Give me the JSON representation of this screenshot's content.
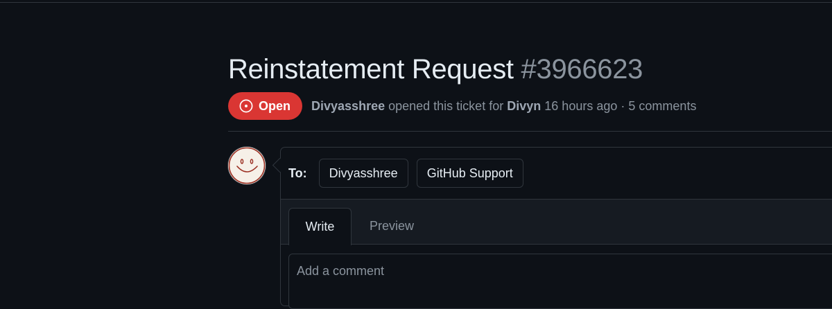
{
  "issue": {
    "title": "Reinstatement Request",
    "number": "#3966623",
    "state": "Open",
    "author": "Divyasshree",
    "opened_text": "opened this ticket for",
    "account": "Divyn",
    "time_ago": "16 hours ago",
    "separator": "·",
    "comments": "5 comments"
  },
  "composer": {
    "to_label": "To:",
    "recipients": [
      "Divyasshree",
      "GitHub Support"
    ],
    "tabs": [
      "Write",
      "Preview"
    ],
    "placeholder": "Add a comment"
  },
  "colors": {
    "background": "#0d1117",
    "open_badge": "#da3633",
    "muted_text": "#8b949e",
    "border": "#30363d"
  },
  "icons": {
    "state": "issue-opened-icon",
    "avatar": "smiley-face-avatar"
  }
}
